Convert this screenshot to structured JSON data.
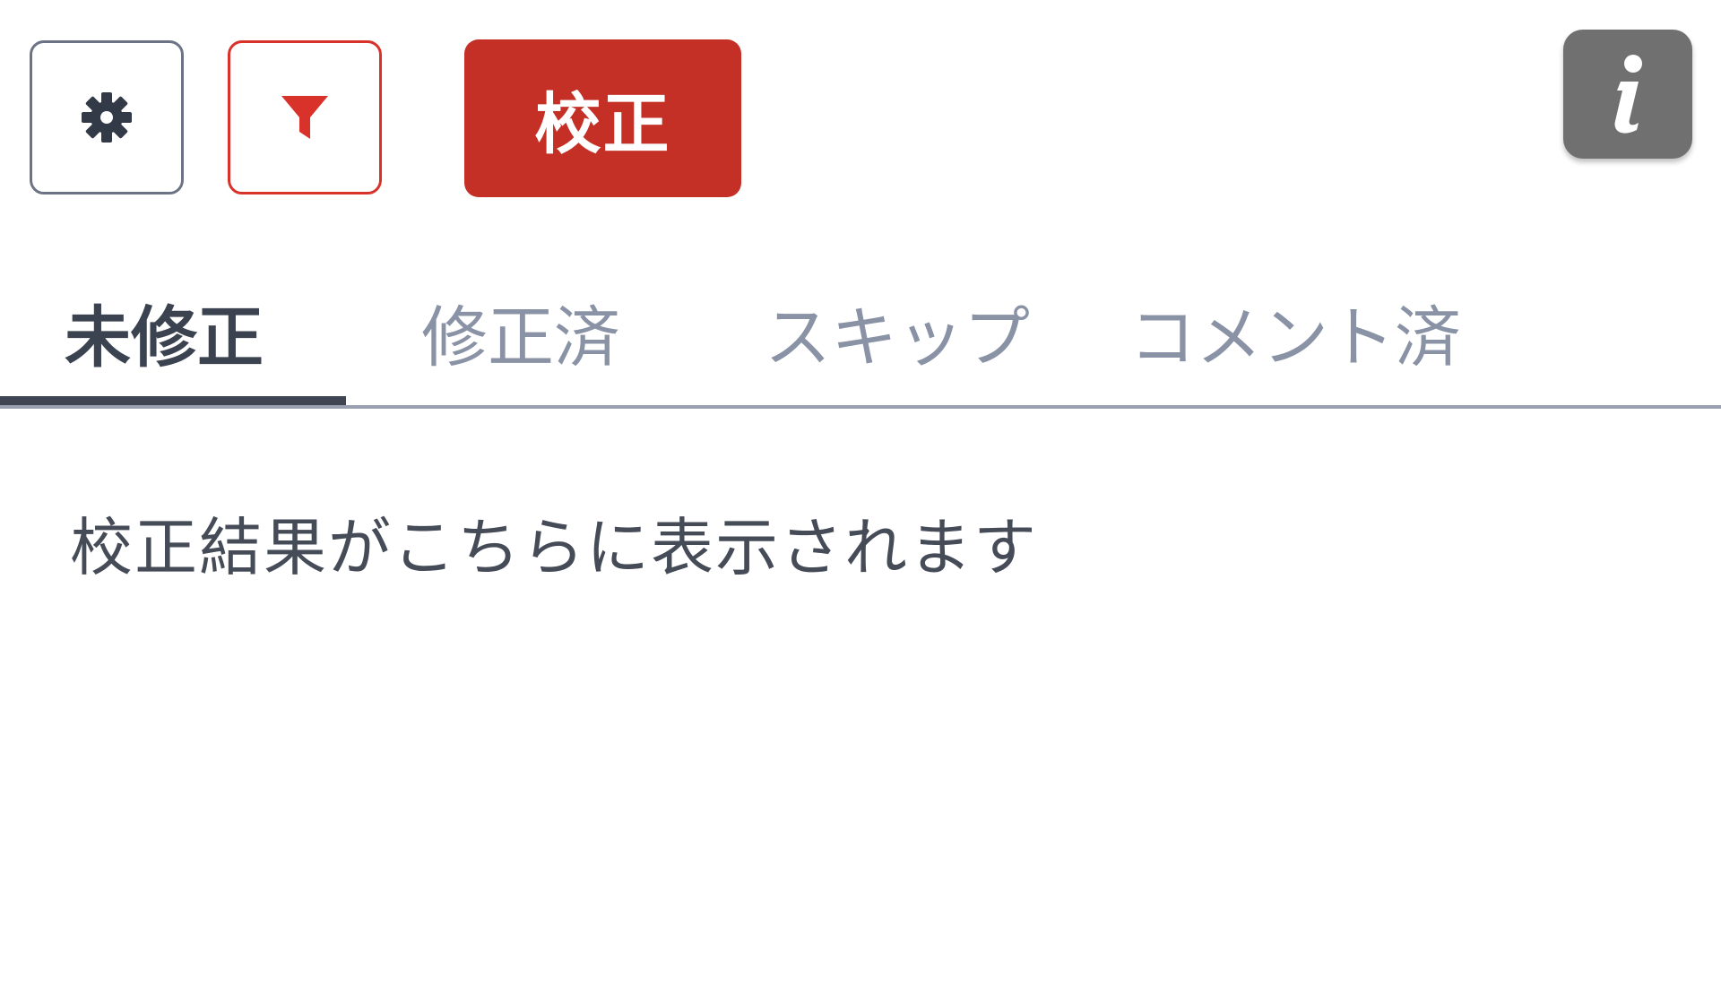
{
  "toolbar": {
    "settings_icon": "gear-icon",
    "filter_icon": "filter-funnel-icon",
    "proofread_label": "校正",
    "info_icon": "info-icon",
    "accent_color": "#c42f26",
    "filter_color": "#d8322b",
    "info_color": "#707070"
  },
  "tabs": [
    {
      "label": "未修正",
      "active": true
    },
    {
      "label": "修正済",
      "active": false
    },
    {
      "label": "スキップ",
      "active": false
    },
    {
      "label": "コメント済",
      "active": false
    }
  ],
  "results": {
    "empty_message": "校正結果がこちらに表示されます"
  }
}
